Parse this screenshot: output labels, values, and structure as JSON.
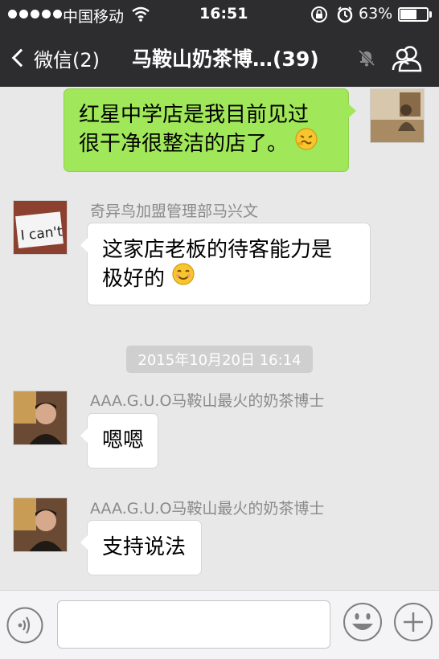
{
  "status_bar": {
    "carrier": "中国移动",
    "time": "16:51",
    "battery_text": "63%",
    "battery_level": 0.63
  },
  "nav": {
    "back_label": "微信(2)",
    "title": "马鞍山奶茶博…(39)"
  },
  "messages": [
    {
      "side": "right",
      "text_line1": "红星中学店是我目前见过",
      "text_line2": "很干净很整洁的店了。"
    },
    {
      "side": "left",
      "sender": "奇异鸟加盟管理部马兴文",
      "avatar_text": "I can't",
      "text_line1": "这家店老板的待客能力是",
      "text_line2": "极好的"
    },
    {
      "side": "left",
      "sender": "AAA.G.U.O马鞍山最火的奶茶博士",
      "text": "嗯嗯"
    },
    {
      "side": "left",
      "sender": "AAA.G.U.O马鞍山最火的奶茶博士",
      "text": "支持说法"
    }
  ],
  "timestamp": "2015年10月20日  16:14",
  "input": {
    "placeholder": ""
  },
  "colors": {
    "bar_bg": "#2d2d2f",
    "chat_bg": "#e8e8e8",
    "my_bubble": "#a0e759",
    "their_bubble": "#ffffff"
  },
  "icons": [
    "signal-dots-icon",
    "wifi-icon",
    "rotation-lock-icon",
    "alarm-icon",
    "battery-icon",
    "back-chevron-icon",
    "mute-icon",
    "group-members-icon",
    "voice-icon",
    "emoji-icon",
    "plus-icon",
    "grimace-emoji",
    "smile-emoji"
  ]
}
